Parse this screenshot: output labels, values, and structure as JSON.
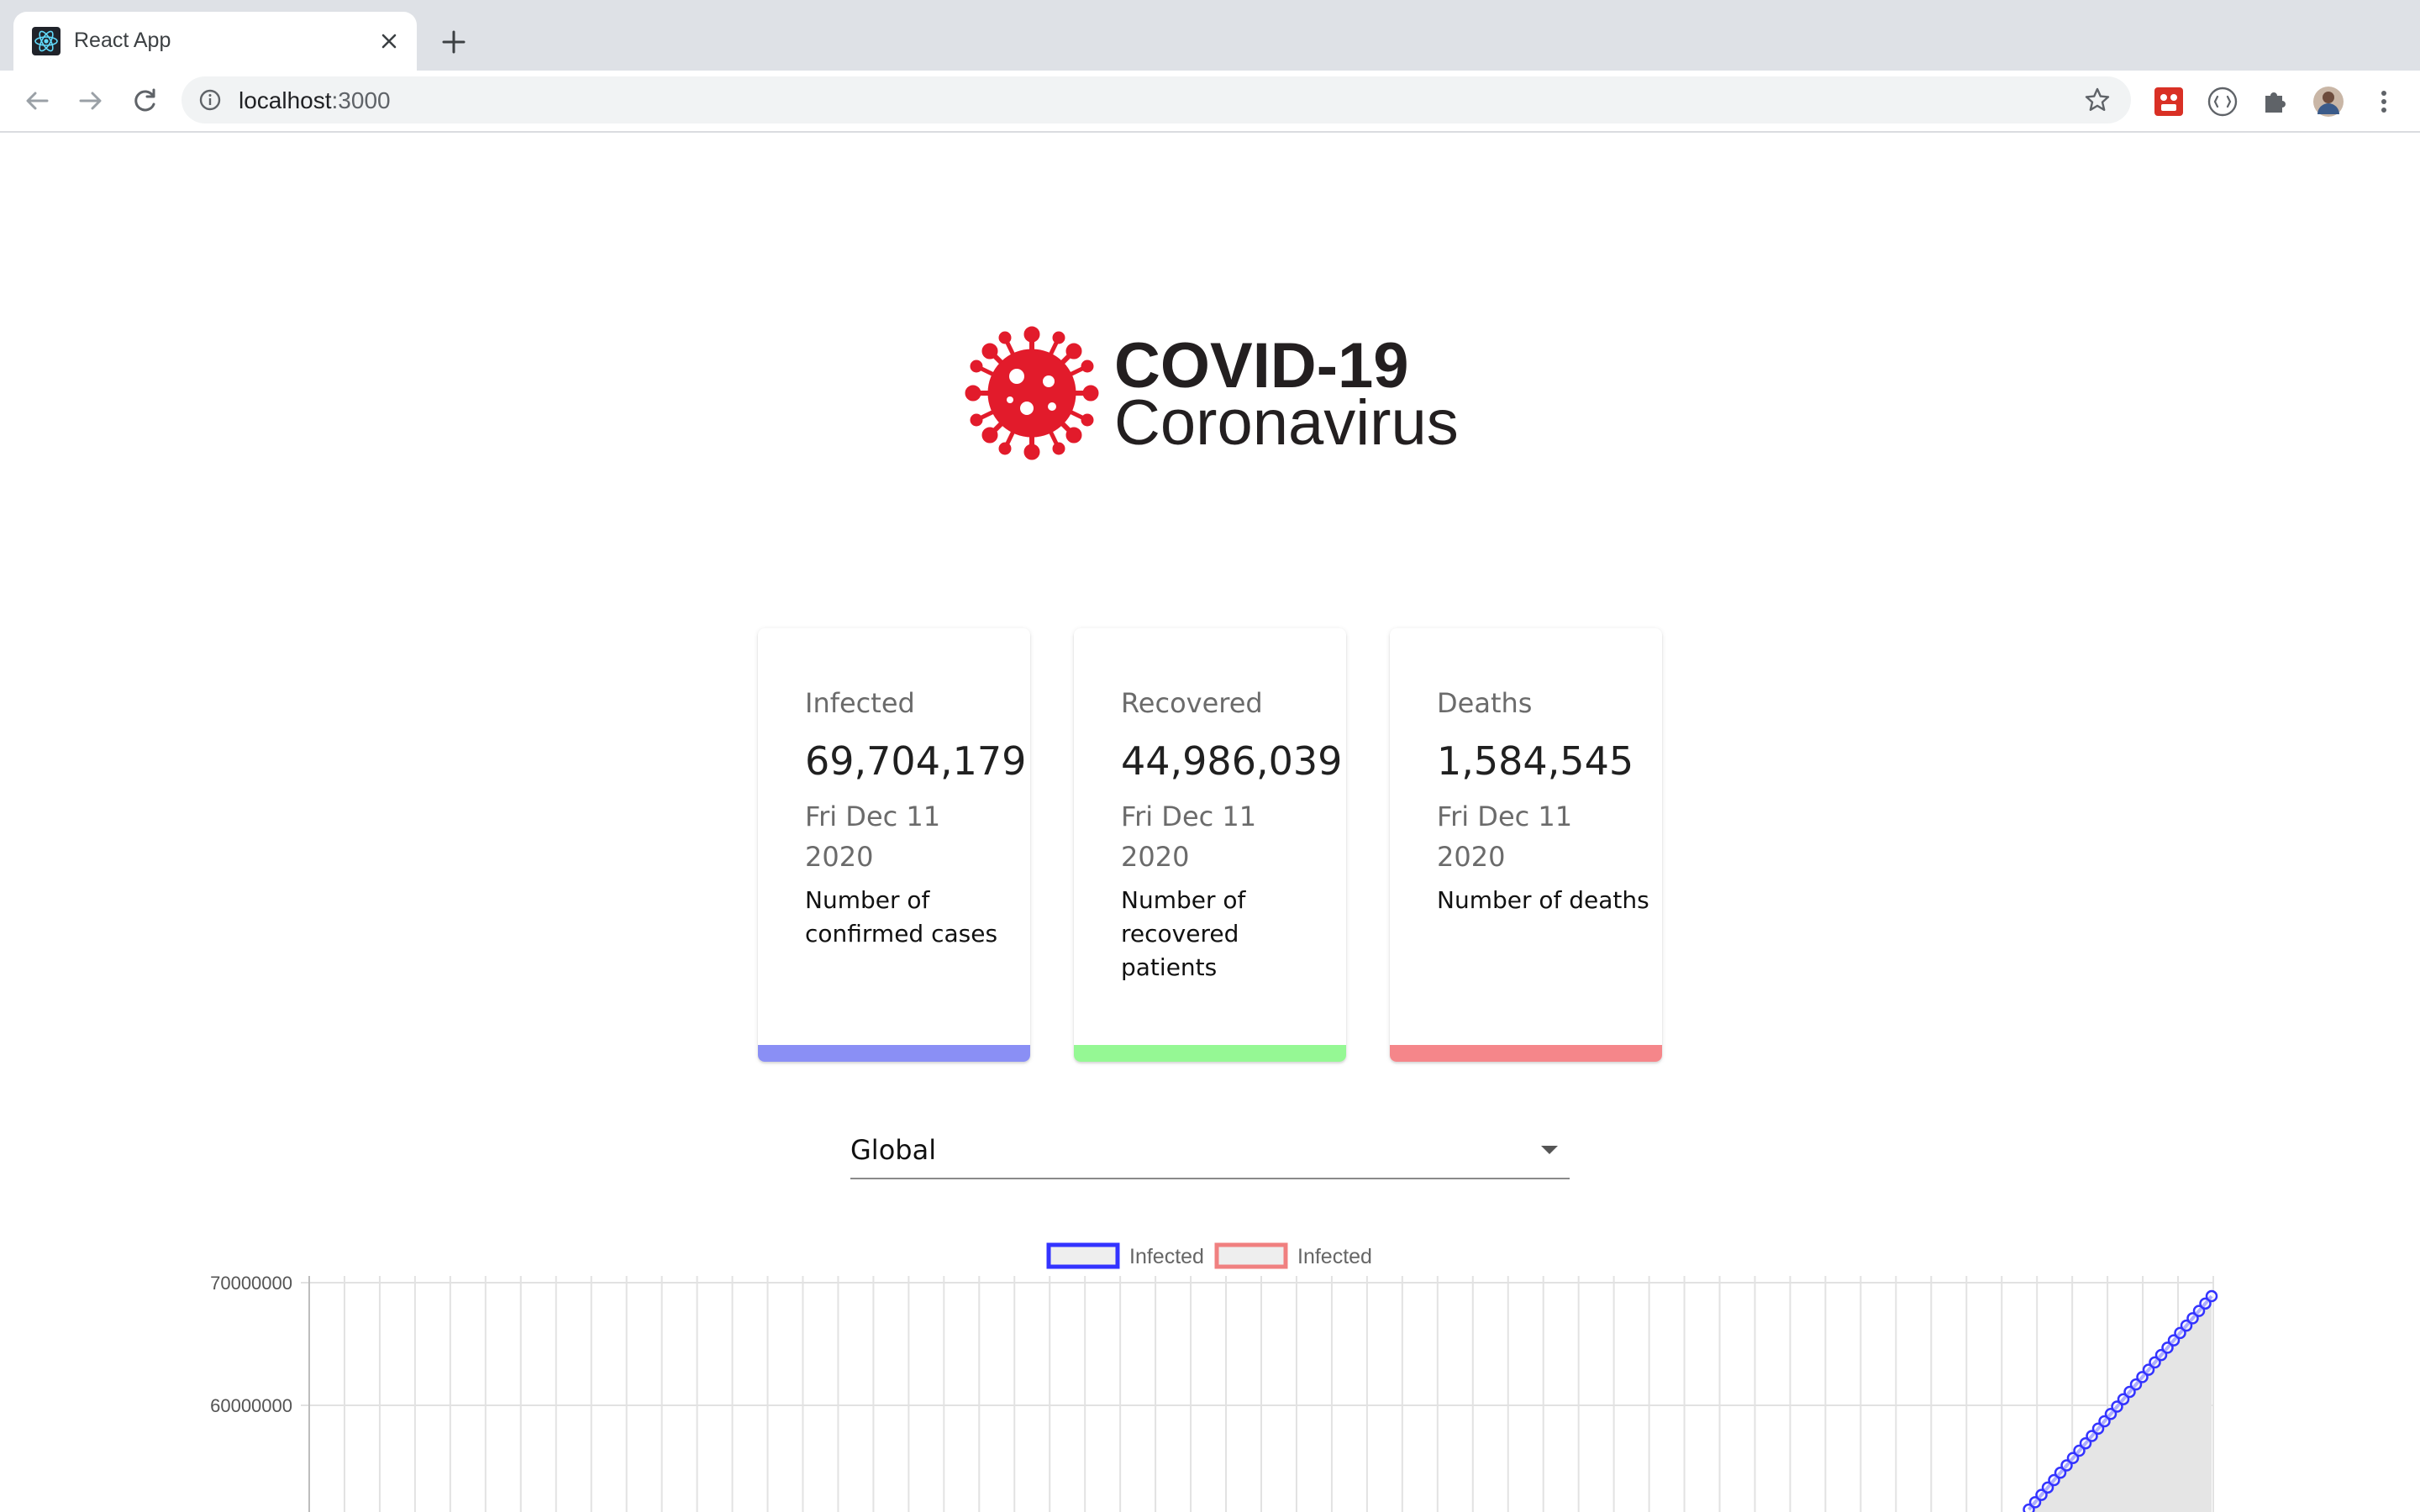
{
  "browser": {
    "tab_title": "React App",
    "url_host": "localhost",
    "url_port": ":3000"
  },
  "logo": {
    "title": "COVID-19",
    "subtitle": "Coronavirus"
  },
  "cards": [
    {
      "label": "Infected",
      "value": "69,704,179",
      "date_line1": "Fri Dec 11",
      "date_line2": "2020",
      "description": "Number of confirmed cases",
      "color": "#8a8ff5"
    },
    {
      "label": "Recovered",
      "value": "44,986,039",
      "date_line1": "Fri Dec 11",
      "date_line2": "2020",
      "description": "Number of recovered patients",
      "color": "#95f894"
    },
    {
      "label": "Deaths",
      "value": "1,584,545",
      "date_line1": "Fri Dec 11",
      "date_line2": "2020",
      "description": "Number of deaths",
      "color": "#f5868a"
    }
  ],
  "country_picker": {
    "selected": "Global"
  },
  "chart_data": {
    "type": "line",
    "legend": [
      {
        "name": "Infected",
        "border_color": "#3333ff",
        "fill_color": "#eeeeee"
      },
      {
        "name": "Infected",
        "border_color": "#f08080",
        "fill_color": "#eeeeee"
      }
    ],
    "legend_position": "top",
    "y_ticks": [
      70000000,
      60000000
    ],
    "ylim_visible": [
      50000000,
      70000000
    ],
    "grid": true,
    "series": [
      {
        "name": "Infected",
        "color": "#3333ff",
        "fill": "#e5e5e5",
        "values_tail": [
          51500000,
          52100000,
          52700000,
          53300000,
          53900000,
          54500000,
          55100000,
          55700000,
          56300000,
          56900000,
          57500000,
          58100000,
          58700000,
          59300000,
          59900000,
          60500000,
          61100000,
          61700000,
          62300000,
          62900000,
          63500000,
          64100000,
          64700000,
          65300000,
          65900000,
          66500000,
          67100000,
          67700000,
          68300000,
          68900000
        ]
      }
    ]
  }
}
